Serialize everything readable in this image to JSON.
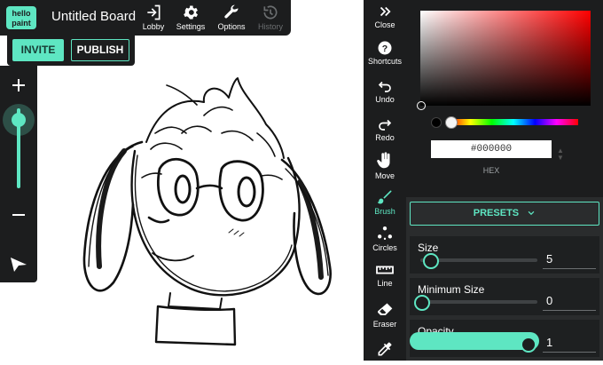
{
  "header": {
    "logo_line1": "hello",
    "logo_line2": "paint",
    "board_title": "Untitled Board",
    "buttons": [
      {
        "label": "Lobby",
        "icon": "lobby-icon"
      },
      {
        "label": "Settings",
        "icon": "gear-icon"
      },
      {
        "label": "Options",
        "icon": "wrench-icon"
      },
      {
        "label": "History",
        "icon": "history-icon"
      }
    ],
    "invite_label": "INVITE",
    "publish_label": "PUBLISH"
  },
  "zoom": {
    "level": 0.2
  },
  "toolbar": {
    "items": [
      {
        "label": "Close",
        "icon": "double-chevron-right-icon"
      },
      {
        "label": "Shortcuts",
        "icon": "help-icon"
      },
      {
        "label": "Undo",
        "icon": "undo-icon"
      },
      {
        "label": "Redo",
        "icon": "redo-icon"
      },
      {
        "label": "Move",
        "icon": "hand-icon"
      },
      {
        "label": "Brush",
        "icon": "brush-icon"
      },
      {
        "label": "Circles",
        "icon": "circles-icon"
      },
      {
        "label": "Line",
        "icon": "ruler-icon"
      },
      {
        "label": "Eraser",
        "icon": "eraser-icon"
      },
      {
        "label": "",
        "icon": "eyedropper-icon"
      }
    ],
    "active_tool": "Brush"
  },
  "color": {
    "hex_value": "#000000",
    "hex_label": "HEX",
    "accent": "#5ee6c2"
  },
  "presets_label": "PRESETS",
  "properties": [
    {
      "label": "Size",
      "value": "5",
      "level": 0.08
    },
    {
      "label": "Minimum Size",
      "value": "0",
      "level": 0.0
    },
    {
      "label": "Opacity",
      "value": "1",
      "level": 1.0
    }
  ]
}
